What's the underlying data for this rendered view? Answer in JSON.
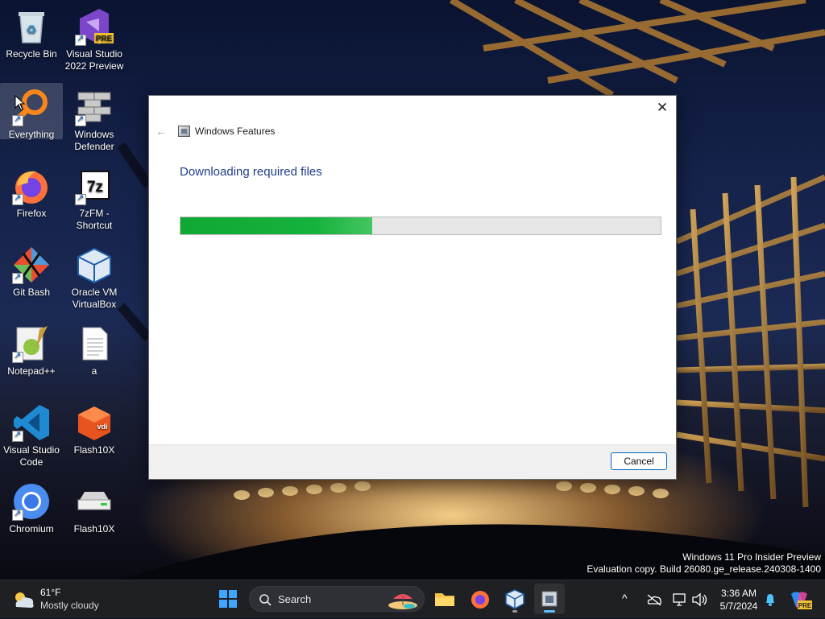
{
  "desktop": {
    "icons": [
      {
        "label": "Recycle Bin"
      },
      {
        "label": "Visual Studio 2022 Preview"
      },
      {
        "label": "Everything"
      },
      {
        "label": "Windows Defender"
      },
      {
        "label": "Firefox"
      },
      {
        "label": "7zFM - Shortcut"
      },
      {
        "label": "Git Bash"
      },
      {
        "label": "Oracle VM VirtualBox"
      },
      {
        "label": "Notepad++"
      },
      {
        "label": "a"
      },
      {
        "label": "Visual Studio Code"
      },
      {
        "label": "Flash10X"
      },
      {
        "label": "Chromium"
      },
      {
        "label": "Flash10X"
      }
    ],
    "icon_badges": {
      "vs_preview": "PRE",
      "sevenzip": "7z",
      "vdi": "vdi"
    }
  },
  "dialog": {
    "title": "Windows Features",
    "heading": "Downloading required files",
    "progress_fraction": 0.4,
    "close_symbol": "✕",
    "back_symbol": "←",
    "cancel_label": "Cancel"
  },
  "watermark": {
    "line1": "Windows 11 Pro Insider Preview",
    "line2": "Evaluation copy. Build 26080.ge_release.240308-1400"
  },
  "taskbar": {
    "weather_temp": "61°F",
    "weather_desc": "Mostly cloudy",
    "search_label": "Search",
    "time": "3:36 AM",
    "date": "5/7/2024",
    "copilot_badge": "PRE",
    "chevron_symbol": "^"
  },
  "colors": {
    "accent": "#0067c0",
    "progress": "#15b23d",
    "heading": "#1f3d8a"
  }
}
